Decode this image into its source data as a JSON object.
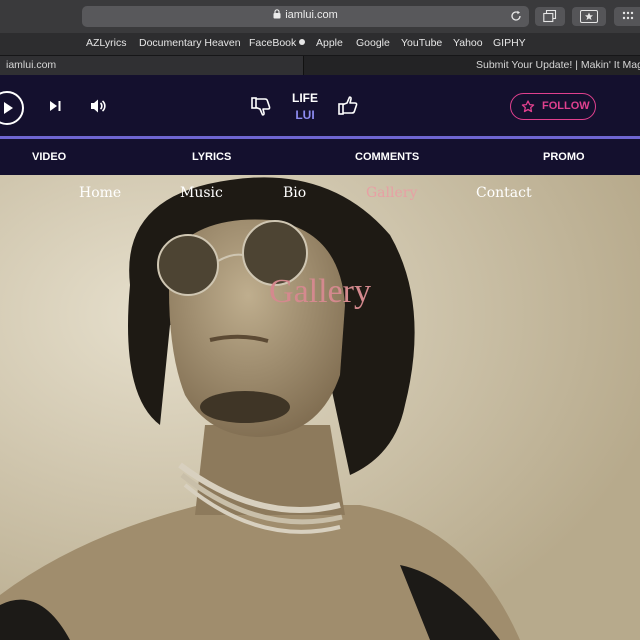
{
  "browser": {
    "url": "iamlui.com",
    "bookmarks": [
      "AZLyrics",
      "Documentary Heaven",
      "FaceBook",
      "Apple",
      "Google",
      "YouTube",
      "Yahoo",
      "GIPHY"
    ],
    "tabs": [
      "iamlui.com",
      "Submit Your Update! | Makin' It Magazine"
    ]
  },
  "player": {
    "track_title": "LIFE",
    "track_artist": "LUI",
    "follow_label": "FOLLOW",
    "accent_color": "#e0408e",
    "nav": [
      "VIDEO",
      "LYRICS",
      "COMMENTS",
      "PROMO"
    ]
  },
  "site": {
    "nav": [
      "Home",
      "Music",
      "Bio",
      "Gallery",
      "Contact"
    ],
    "active_nav": "Gallery",
    "heading": "Gallery"
  }
}
